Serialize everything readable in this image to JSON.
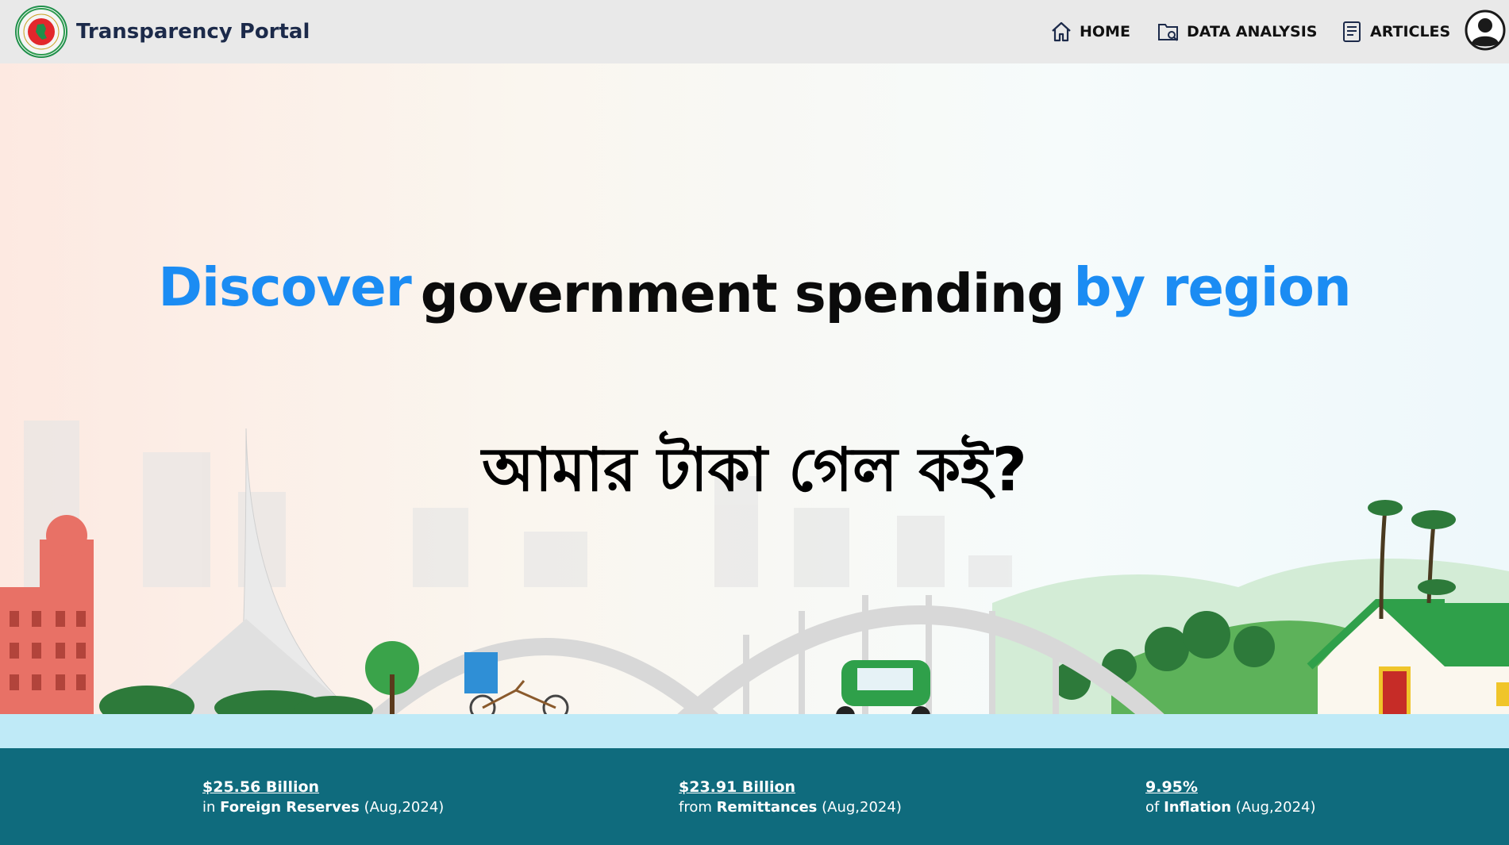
{
  "header": {
    "brand": "Transparency Portal",
    "nav": [
      {
        "label": "HOME",
        "icon": "home-icon"
      },
      {
        "label": "DATA ANALYSIS",
        "icon": "folder-search-icon"
      },
      {
        "label": "ARTICLES",
        "icon": "document-icon"
      }
    ],
    "avatar_icon": "user-icon"
  },
  "hero": {
    "word1": "Discover",
    "word2": "government spending",
    "word3": "by region",
    "bangla": "আমার টাকা গেল কই?"
  },
  "stats": [
    {
      "value": "$25.56 Billion",
      "prefix": "in",
      "label": "Foreign Reserves",
      "period": "(Aug,2024)"
    },
    {
      "value": "$23.91 Billion",
      "prefix": "from",
      "label": "Remittances",
      "period": "(Aug,2024)"
    },
    {
      "value": "9.95%",
      "prefix": "of",
      "label": "Inflation",
      "period": "(Aug,2024)"
    }
  ],
  "colors": {
    "accent": "#1b8cf3",
    "footer_band": "#0f6b7d",
    "header_bg": "#e9e9e9",
    "brand_text": "#1c2a4a"
  }
}
